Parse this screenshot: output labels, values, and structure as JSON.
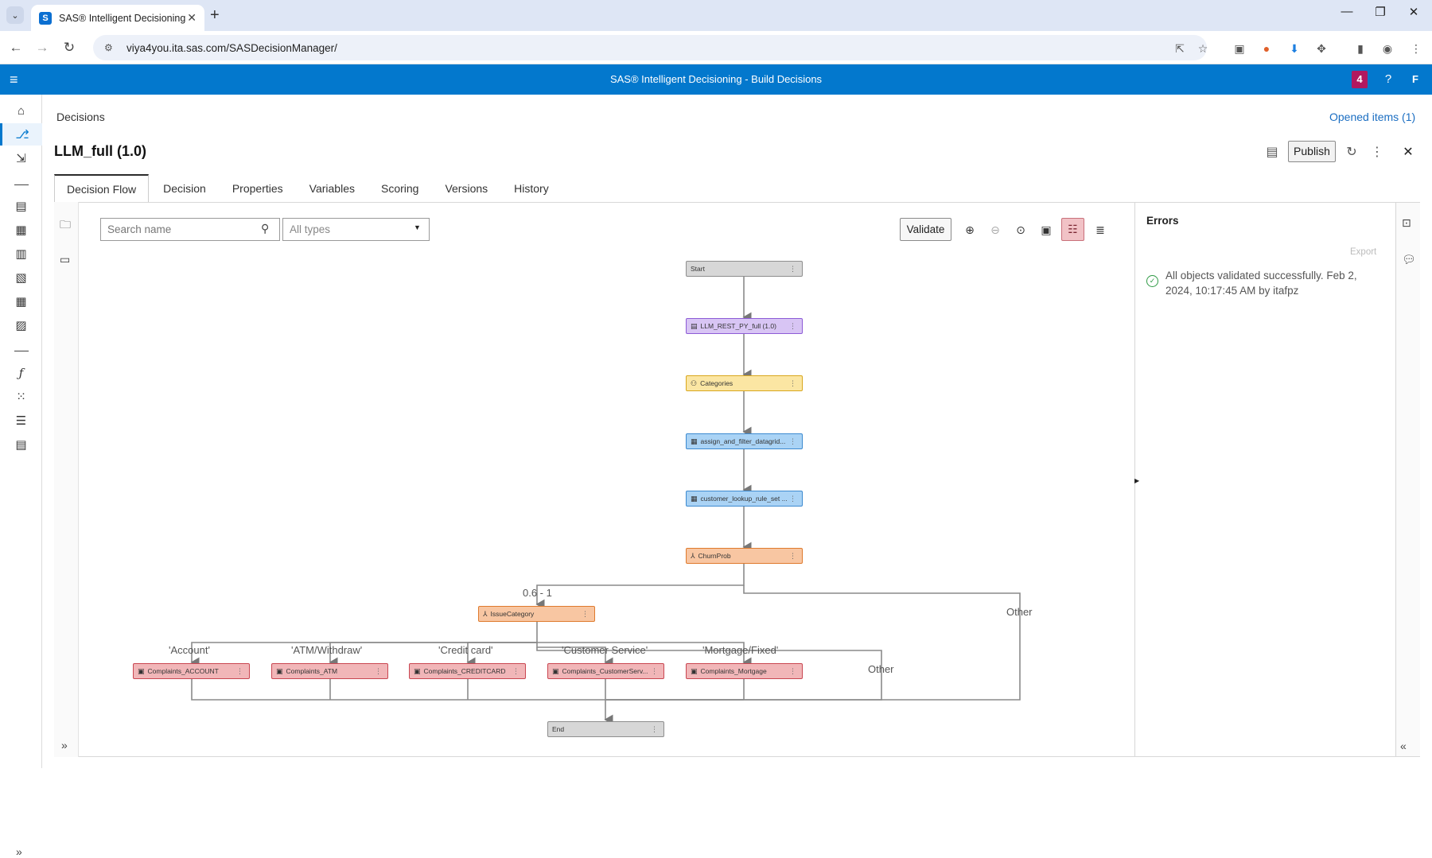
{
  "browser": {
    "tab_title": "SAS® Intelligent Decisioning",
    "tab_favicon": "S",
    "url": "viya4you.ita.sas.com/SASDecisionManager/"
  },
  "app": {
    "title": "SAS® Intelligent Decisioning - Build Decisions",
    "notification_count": "4",
    "help": "?",
    "user_initial": "F"
  },
  "page": {
    "breadcrumb": "Decisions",
    "opened_items": "Opened items (1)",
    "title": "LLM_full (1.0)",
    "publish_label": "Publish"
  },
  "tabs": [
    {
      "label": "Decision Flow"
    },
    {
      "label": "Decision"
    },
    {
      "label": "Properties"
    },
    {
      "label": "Variables"
    },
    {
      "label": "Scoring"
    },
    {
      "label": "Versions"
    },
    {
      "label": "History"
    }
  ],
  "canvas": {
    "search_placeholder": "Search name",
    "type_filter": "All types",
    "validate_label": "Validate"
  },
  "errors": {
    "title": "Errors",
    "export_label": "Export",
    "message": "All objects validated successfully. Feb 2, 2024, 10:17:45 AM by itafpz"
  },
  "flow": {
    "nodes": [
      {
        "label": "Start",
        "kind": "start",
        "icon": ""
      },
      {
        "label": "LLM_REST_PY_full (1.0)",
        "kind": "code-file",
        "icon": "code-icon"
      },
      {
        "label": "Categories",
        "kind": "branch",
        "icon": "branch-icon"
      },
      {
        "label": "assign_and_filter_datagrid...",
        "kind": "rule-set",
        "icon": "ruleset-icon"
      },
      {
        "label": "customer_lookup_rule_set ...",
        "kind": "rule-set",
        "icon": "ruleset-icon"
      },
      {
        "label": "ChurnProb",
        "kind": "condition",
        "icon": "branch-icon"
      },
      {
        "label": "IssueCategory",
        "kind": "condition",
        "icon": "branch-icon"
      },
      {
        "label": "Complaints_ACCOUNT",
        "kind": "treatment",
        "icon": "treatment-icon"
      },
      {
        "label": "Complaints_ATM",
        "kind": "treatment",
        "icon": "treatment-icon"
      },
      {
        "label": "Complaints_CREDITCARD",
        "kind": "treatment",
        "icon": "treatment-icon"
      },
      {
        "label": "Complaints_CustomerServ...",
        "kind": "treatment",
        "icon": "treatment-icon"
      },
      {
        "label": "Complaints_Mortgage",
        "kind": "treatment",
        "icon": "treatment-icon"
      },
      {
        "label": "End",
        "kind": "end",
        "icon": ""
      }
    ],
    "edge_labels": {
      "range": "0.6 - 1",
      "other_churn": "Other",
      "other_issue": "Other",
      "account": "'Account'",
      "atm": "'ATM/Withdraw'",
      "credit": "'Credit card'",
      "customer": "'Customer Service'",
      "mortgage": "'Mortgage/Fixed'"
    }
  },
  "colors": {
    "header_blue": "#0378cd",
    "badge": "#b2185f",
    "node_gray": "#d7d7d7",
    "node_purple": "#d8c5f4",
    "node_yellow": "#fbe6a3",
    "node_blue": "#aad3f5",
    "node_orange": "#f8c6a2",
    "node_red": "#f1b6b8",
    "success_green": "#2e9a44"
  }
}
